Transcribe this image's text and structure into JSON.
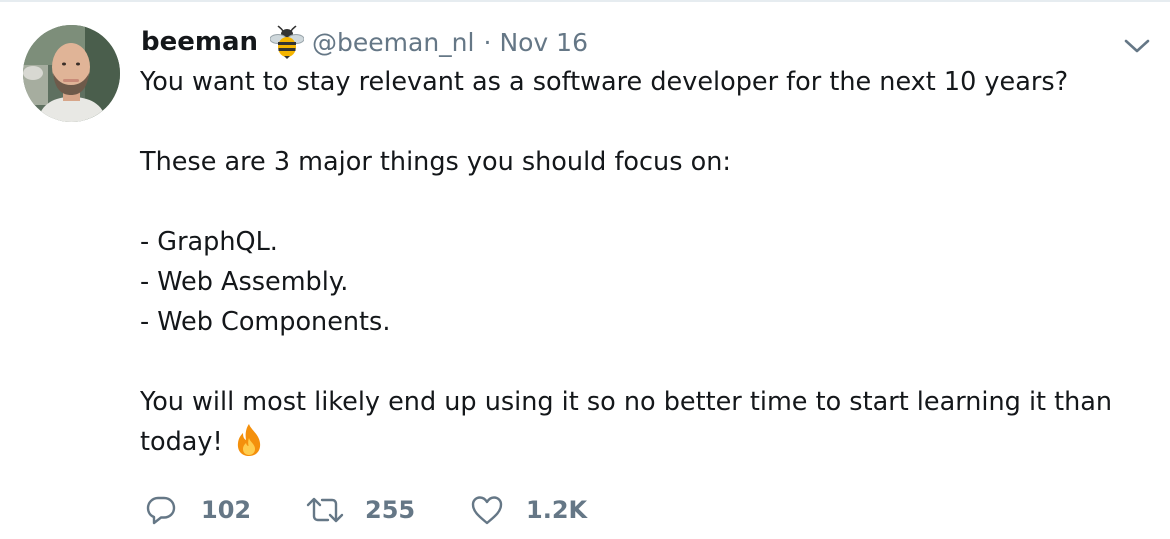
{
  "tweet": {
    "display_name": "beeman",
    "handle": "@beeman_nl",
    "separator": "·",
    "timestamp": "Nov 16",
    "lines": [
      "You want to stay relevant as a software developer for the next 10 years?",
      "",
      "These are 3 major things you should focus on:",
      "",
      "- GraphQL.",
      "- Web Assembly.",
      "- Web Components.",
      "",
      "You will most likely end up using it so no better time to start learning it than",
      "today!"
    ],
    "icons": {
      "name_emoji": "bee-icon",
      "trailing_emoji": "fire-icon",
      "menu": "chevron-down-icon",
      "reply": "reply-icon",
      "retweet": "retweet-icon",
      "like": "heart-icon"
    }
  },
  "actions": {
    "replies": "102",
    "retweets": "255",
    "likes": "1.2K"
  },
  "colors": {
    "text_primary": "#14171a",
    "text_secondary": "#657786",
    "border": "#e6ecf0"
  }
}
